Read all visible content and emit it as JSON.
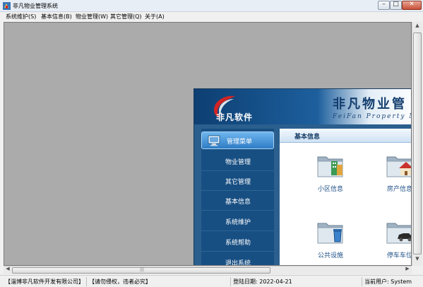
{
  "window": {
    "title": "非凡物业管理系统",
    "controls": {
      "minimize": "–",
      "maximize": "□",
      "close": "✕"
    }
  },
  "menubar": {
    "items": [
      {
        "label": "系统维护(S)"
      },
      {
        "label": "基本信息(B)"
      },
      {
        "label": "物业管理(W)"
      },
      {
        "label": "其它管理(Q)"
      },
      {
        "label": "关于(A)"
      }
    ]
  },
  "child": {
    "logo_text": "非凡软件",
    "brand_title": "非凡物业管",
    "brand_subtitle": "FeiFan Property Ma",
    "menu_header": "管理菜单",
    "nav_items": [
      {
        "label": "物业管理"
      },
      {
        "label": "其它管理"
      },
      {
        "label": "基本信息"
      },
      {
        "label": "系统维护"
      },
      {
        "label": "系统帮助"
      },
      {
        "label": "退出系统"
      }
    ],
    "content_title": "基本信息",
    "tiles": [
      {
        "label": "小区信息",
        "icon": "building-folder-icon"
      },
      {
        "label": "房产信息",
        "icon": "house-folder-icon"
      },
      {
        "label": "公共设施",
        "icon": "trash-can-folder-icon"
      },
      {
        "label": "停车车位",
        "icon": "car-folder-icon"
      }
    ]
  },
  "statusbar": {
    "company": "【淄博非凡软件开发有限公司】",
    "copyright": "【请勿侵权，违者必究】",
    "login_date": "登陆日期: 2022-04-21",
    "current_user": "当前用户: System"
  },
  "colors": {
    "banner_dark": "#0d3f72",
    "menu_bg": "#184f83",
    "accent_text": "#1c4f86",
    "logo_red": "#d32424"
  }
}
